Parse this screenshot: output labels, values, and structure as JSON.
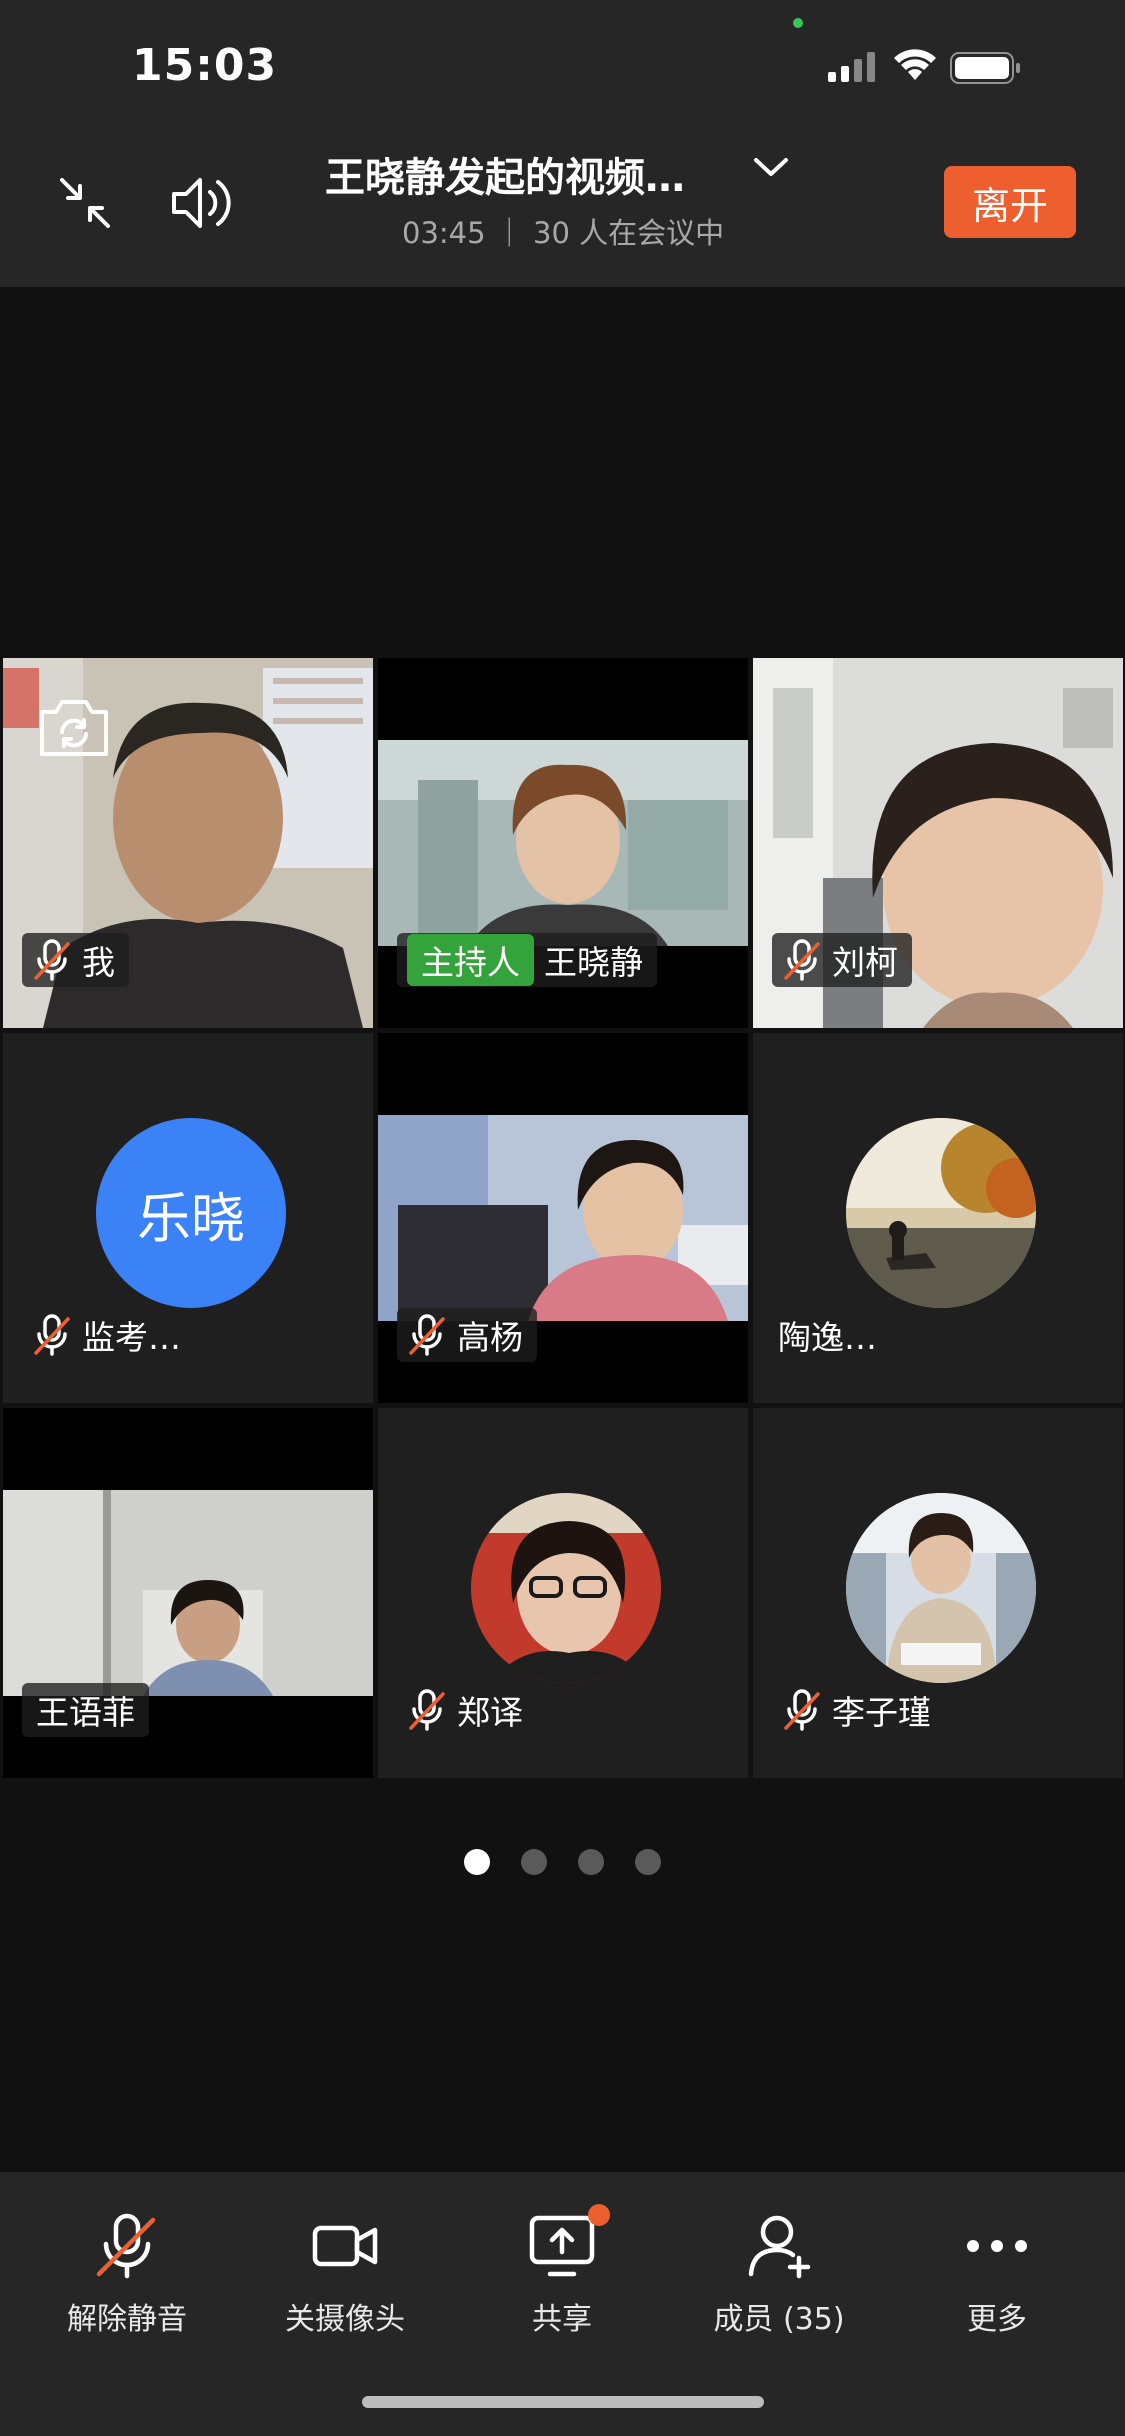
{
  "status_bar": {
    "time": "15:03"
  },
  "header": {
    "title": "王晓静发起的视频…",
    "subtitle": "03:45 ｜ 30 人在会议中",
    "leave_label": "离开"
  },
  "participants": [
    {
      "name": "我",
      "muted": true
    },
    {
      "name": "王晓静",
      "host_badge": "主持人",
      "muted": false
    },
    {
      "name": "刘柯",
      "muted": true
    },
    {
      "name": "监考…",
      "muted": true,
      "avatar_text": "乐晓"
    },
    {
      "name": "高杨",
      "muted": true
    },
    {
      "name": "陶逸…",
      "muted": false
    },
    {
      "name": "王语菲",
      "muted": false
    },
    {
      "name": "郑译",
      "muted": true
    },
    {
      "name": "李子瑾",
      "muted": true
    }
  ],
  "pager": {
    "pages": 4,
    "current": 1
  },
  "toolbar": {
    "unmute": "解除静音",
    "camera": "关摄像头",
    "share": "共享",
    "members": "成员 (35)",
    "more": "更多"
  },
  "colors": {
    "accent": "#ee5f2f",
    "host": "#35a33b",
    "avatar_blue": "#3b82f6",
    "background": "#111111"
  }
}
